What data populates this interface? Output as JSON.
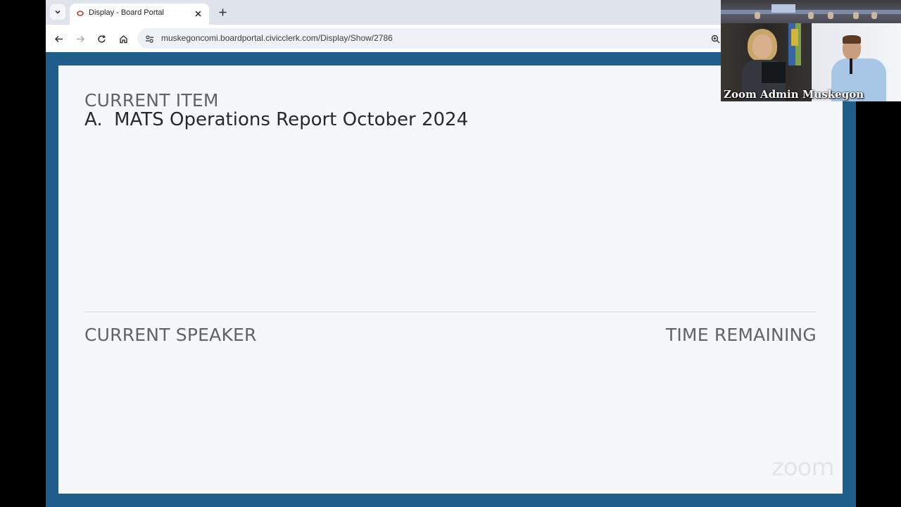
{
  "browser": {
    "tab": {
      "title": "Display - Board Portal",
      "favicon": "civicclerk-icon"
    },
    "address_bar": {
      "url": "muskegoncomi.boardportal.civicclerk.com/Display/Show/2786"
    }
  },
  "display": {
    "current_item_label": "CURRENT ITEM",
    "current_item_value": "A.  MATS Operations Report October 2024",
    "current_speaker_label": "CURRENT SPEAKER",
    "time_remaining_label": "TIME REMAINING"
  },
  "video_overlay": {
    "participant_name": "Zoom Admin Muskegon",
    "watermark": "zoom"
  },
  "colors": {
    "frame": "#1f5d8a",
    "panel": "#f5f7fa",
    "label_text": "#5f6468",
    "value_text": "#252a2e"
  }
}
